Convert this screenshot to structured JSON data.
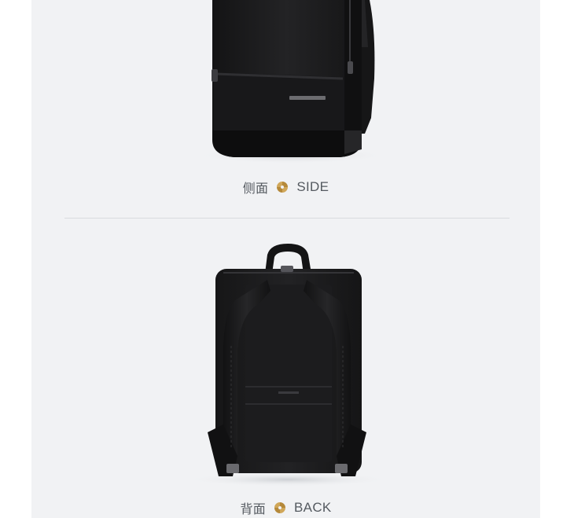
{
  "sections": [
    {
      "label_cn": "侧面",
      "label_en": "SIDE"
    },
    {
      "label_cn": "背面",
      "label_en": "BACK"
    }
  ],
  "colors": {
    "background": "#f1f2f4",
    "bag": "#1b1b1c",
    "logo_accent": "#b5893a"
  },
  "icons": [
    "samsonite-logo-icon"
  ]
}
